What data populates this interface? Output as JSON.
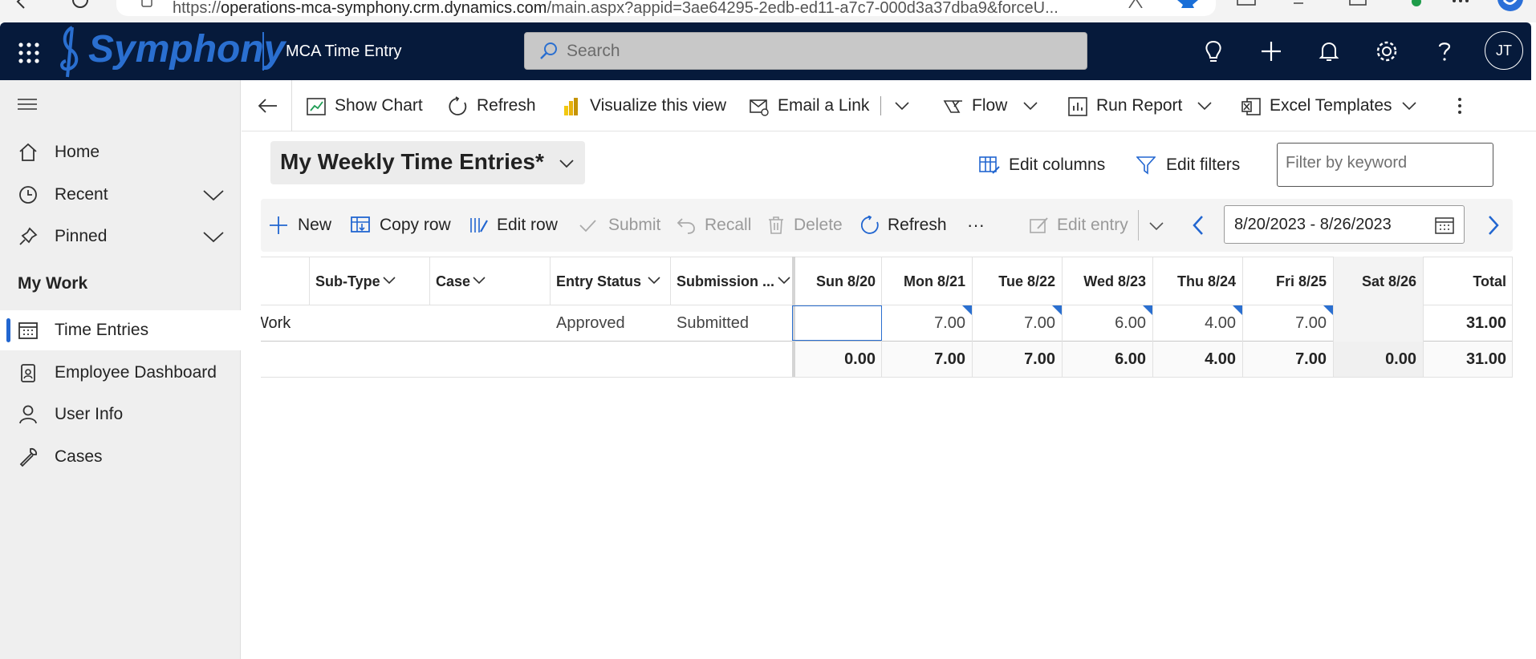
{
  "browser": {
    "url_prefix": "https://",
    "url_host": "operations-mca-symphony.crm.dynamics.com",
    "url_path": "/main.aspx?appid=3ae64295-2edb-ed11-a7c7-000d3a37dba9&forceU..."
  },
  "header": {
    "brand": "Symphony",
    "app_name": "MCA Time Entry",
    "search_placeholder": "Search",
    "avatar_initials": "JT"
  },
  "sidebar": {
    "items": [
      {
        "label": "Home"
      },
      {
        "label": "Recent"
      },
      {
        "label": "Pinned"
      }
    ],
    "section_title": "My Work",
    "work_items": [
      {
        "label": "Time Entries"
      },
      {
        "label": "Employee Dashboard"
      },
      {
        "label": "User Info"
      },
      {
        "label": "Cases"
      }
    ]
  },
  "command_bar": {
    "show_chart": "Show Chart",
    "refresh": "Refresh",
    "visualize": "Visualize this view",
    "email_link": "Email a Link",
    "flow": "Flow",
    "run_report": "Run Report",
    "excel_templates": "Excel Templates"
  },
  "view": {
    "title": "My Weekly Time Entries*",
    "edit_columns": "Edit columns",
    "edit_filters": "Edit filters",
    "filter_placeholder": "Filter by keyword"
  },
  "grid_toolbar": {
    "new": "New",
    "copy_row": "Copy row",
    "edit_row": "Edit row",
    "submit": "Submit",
    "recall": "Recall",
    "delete": "Delete",
    "refresh": "Refresh",
    "more": "···",
    "edit_entry": "Edit entry",
    "date_range": "8/20/2023 - 8/26/2023"
  },
  "grid": {
    "columns": [
      "Sub-Type",
      "Case",
      "Entry Status",
      "Submission ...",
      "Sun 8/20",
      "Mon 8/21",
      "Tue 8/22",
      "Wed 8/23",
      "Thu 8/24",
      "Fri 8/25",
      "Sat 8/26",
      "Total"
    ],
    "row": {
      "first_cell": "Work",
      "entry_status": "Approved",
      "submission": "Submitted",
      "days": [
        "",
        "7.00",
        "7.00",
        "6.00",
        "4.00",
        "7.00",
        ""
      ],
      "total": "31.00"
    },
    "totals": {
      "days": [
        "0.00",
        "7.00",
        "7.00",
        "6.00",
        "4.00",
        "7.00",
        "0.00"
      ],
      "total": "31.00"
    }
  }
}
